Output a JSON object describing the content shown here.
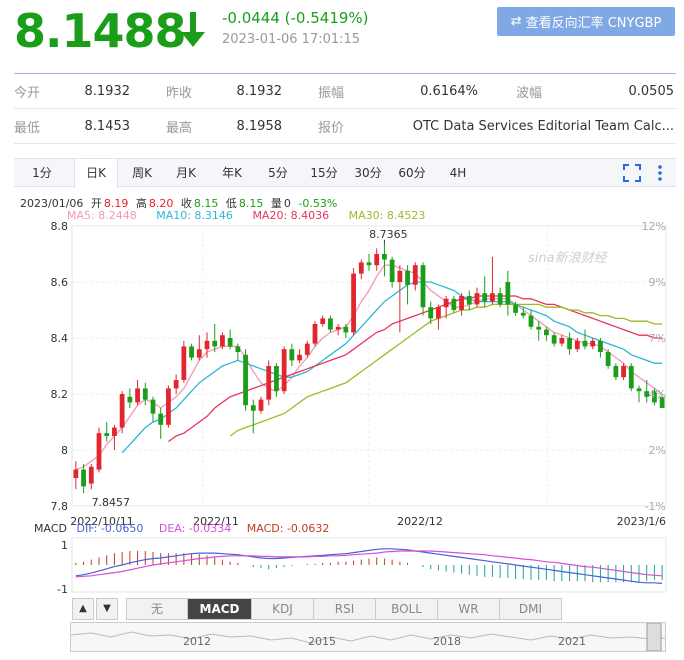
{
  "quote": {
    "price": "8.1488",
    "change": "-0.0444 (-0.5419%)",
    "datetime": "2023-01-06 17:01:15",
    "reverse_button": "查看反向汇率 CNYGBP",
    "down_color": "#1a9e1a",
    "up_color": "#e0262e"
  },
  "stats": [
    [
      {
        "label": "今开",
        "value": "8.1932"
      },
      {
        "label": "昨收",
        "value": "8.1932"
      },
      {
        "label": "振幅",
        "value": "0.6164%"
      },
      {
        "label": "波幅",
        "value": "0.0505"
      }
    ],
    [
      {
        "label": "最低",
        "value": "8.1453"
      },
      {
        "label": "最高",
        "value": "8.1958"
      },
      {
        "label": "报价",
        "value": "OTC Data Services Editorial Team Calc..."
      }
    ]
  ],
  "periods": [
    "1分",
    "日K",
    "周K",
    "月K",
    "年K",
    "5分",
    "15分",
    "30分",
    "60分",
    "4H"
  ],
  "active_period": "日K",
  "ohlc_line": {
    "date": "2023/01/06",
    "open_label": "开",
    "open": "8.19",
    "high_label": "高",
    "high": "8.20",
    "close_label": "收",
    "close": "8.15",
    "low_label": "低",
    "low": "8.15",
    "vol_label": "量",
    "vol": "0",
    "pct": "-0.53%"
  },
  "ma_legend": [
    {
      "text": "MA5: 8.2448",
      "color": "#f09ab6"
    },
    {
      "text": "MA10: 8.3146",
      "color": "#2db7d6"
    },
    {
      "text": "MA20: 8.4036",
      "color": "#e8335b"
    },
    {
      "text": "MA30: 8.4523",
      "color": "#9fb82a"
    }
  ],
  "watermark": "sina新浪财经",
  "chart_data": {
    "type": "candlestick",
    "y_ticks": [
      "8.8",
      "8.6",
      "8.4",
      "8.2",
      "8",
      "7.8"
    ],
    "pct_ticks": [
      "12%",
      "9%",
      "7%",
      "4%",
      "2%",
      "-1%"
    ],
    "ylim": [
      7.8,
      8.8
    ],
    "x_labels": [
      "2022/10/11",
      "2022/11",
      "2022/12",
      "2023/1/6"
    ],
    "max_label": "8.7365",
    "min_label": "7.8457",
    "candles": [
      [
        7.9,
        7.93,
        7.96,
        7.86
      ],
      [
        7.93,
        7.87,
        7.95,
        7.8457
      ],
      [
        7.88,
        7.94,
        7.95,
        7.86
      ],
      [
        7.93,
        8.06,
        8.08,
        7.92
      ],
      [
        8.06,
        8.05,
        8.1,
        8.03
      ],
      [
        8.05,
        8.08,
        8.09,
        8.0
      ],
      [
        8.08,
        8.2,
        8.21,
        8.06
      ],
      [
        8.19,
        8.17,
        8.22,
        8.15
      ],
      [
        8.17,
        8.22,
        8.25,
        8.16
      ],
      [
        8.22,
        8.18,
        8.24,
        8.16
      ],
      [
        8.18,
        8.13,
        8.19,
        8.1
      ],
      [
        8.13,
        8.09,
        8.15,
        8.04
      ],
      [
        8.09,
        8.22,
        8.23,
        8.08
      ],
      [
        8.22,
        8.25,
        8.27,
        8.2
      ],
      [
        8.25,
        8.37,
        8.39,
        8.24
      ],
      [
        8.37,
        8.33,
        8.38,
        8.32
      ],
      [
        8.33,
        8.36,
        8.41,
        8.32
      ],
      [
        8.36,
        8.39,
        8.42,
        8.33
      ],
      [
        8.39,
        8.37,
        8.45,
        8.35
      ],
      [
        8.37,
        8.41,
        8.42,
        8.36
      ],
      [
        8.4,
        8.37,
        8.43,
        8.36
      ],
      [
        8.37,
        8.35,
        8.38,
        8.32
      ],
      [
        8.34,
        8.16,
        8.36,
        8.14
      ],
      [
        8.16,
        8.14,
        8.18,
        8.06
      ],
      [
        8.14,
        8.18,
        8.19,
        8.13
      ],
      [
        8.18,
        8.3,
        8.32,
        8.16
      ],
      [
        8.3,
        8.21,
        8.31,
        8.19
      ],
      [
        8.21,
        8.36,
        8.37,
        8.2
      ],
      [
        8.36,
        8.32,
        8.38,
        8.3
      ],
      [
        8.32,
        8.34,
        8.36,
        8.31
      ],
      [
        8.34,
        8.38,
        8.39,
        8.33
      ],
      [
        8.38,
        8.45,
        8.46,
        8.37
      ],
      [
        8.45,
        8.47,
        8.48,
        8.44
      ],
      [
        8.47,
        8.43,
        8.48,
        8.42
      ],
      [
        8.43,
        8.44,
        8.45,
        8.41
      ],
      [
        8.44,
        8.42,
        8.45,
        8.4
      ],
      [
        8.42,
        8.63,
        8.65,
        8.41
      ],
      [
        8.63,
        8.67,
        8.68,
        8.61
      ],
      [
        8.67,
        8.66,
        8.7,
        8.64
      ],
      [
        8.66,
        8.7,
        8.72,
        8.64
      ],
      [
        8.7,
        8.68,
        8.7365,
        8.62
      ],
      [
        8.68,
        8.6,
        8.69,
        8.58
      ],
      [
        8.6,
        8.64,
        8.66,
        8.42
      ],
      [
        8.64,
        8.59,
        8.66,
        8.52
      ],
      [
        8.59,
        8.66,
        8.67,
        8.57
      ],
      [
        8.66,
        8.51,
        8.67,
        8.48
      ],
      [
        8.51,
        8.47,
        8.53,
        8.45
      ],
      [
        8.47,
        8.51,
        8.52,
        8.43
      ],
      [
        8.51,
        8.54,
        8.55,
        8.47
      ],
      [
        8.54,
        8.5,
        8.55,
        8.49
      ],
      [
        8.5,
        8.55,
        8.56,
        8.48
      ],
      [
        8.55,
        8.52,
        8.57,
        8.5
      ],
      [
        8.52,
        8.56,
        8.58,
        8.51
      ],
      [
        8.56,
        8.53,
        8.62,
        8.51
      ],
      [
        8.53,
        8.56,
        8.69,
        8.52
      ],
      [
        8.56,
        8.52,
        8.58,
        8.51
      ],
      [
        8.6,
        8.52,
        8.64,
        8.48
      ],
      [
        8.52,
        8.49,
        8.53,
        8.48
      ],
      [
        8.49,
        8.48,
        8.51,
        8.47
      ],
      [
        8.48,
        8.44,
        8.5,
        8.43
      ],
      [
        8.44,
        8.43,
        8.46,
        8.39
      ],
      [
        8.43,
        8.41,
        8.44,
        8.39
      ],
      [
        8.41,
        8.38,
        8.42,
        8.37
      ],
      [
        8.38,
        8.4,
        8.41,
        8.37
      ],
      [
        8.4,
        8.36,
        8.42,
        8.34
      ],
      [
        8.36,
        8.39,
        8.4,
        8.35
      ],
      [
        8.39,
        8.37,
        8.43,
        8.36
      ],
      [
        8.37,
        8.39,
        8.4,
        8.36
      ],
      [
        8.39,
        8.35,
        8.4,
        8.33
      ],
      [
        8.35,
        8.3,
        8.36,
        8.29
      ],
      [
        8.3,
        8.26,
        8.31,
        8.25
      ],
      [
        8.26,
        8.3,
        8.31,
        8.25
      ],
      [
        8.3,
        8.22,
        8.31,
        8.21
      ],
      [
        8.22,
        8.21,
        8.23,
        8.17
      ],
      [
        8.21,
        8.19,
        8.25,
        8.17
      ],
      [
        8.21,
        8.17,
        8.22,
        8.16
      ],
      [
        8.19,
        8.15,
        8.2,
        8.15
      ]
    ],
    "ma": {
      "MA5": [
        7.93,
        7.94,
        7.96,
        7.98,
        8.02,
        8.05,
        8.08,
        8.12,
        8.16,
        8.18,
        8.17,
        8.15,
        8.17,
        8.19,
        8.22,
        8.27,
        8.32,
        8.35,
        8.36,
        8.37,
        8.37,
        8.37,
        8.33,
        8.28,
        8.24,
        8.22,
        8.21,
        8.23,
        8.26,
        8.3,
        8.33,
        8.37,
        8.4,
        8.42,
        8.43,
        8.44,
        8.48,
        8.53,
        8.57,
        8.62,
        8.66,
        8.66,
        8.65,
        8.64,
        8.63,
        8.6,
        8.57,
        8.55,
        8.53,
        8.51,
        8.51,
        8.52,
        8.53,
        8.54,
        8.54,
        8.54,
        8.54,
        8.52,
        8.5,
        8.48,
        8.46,
        8.44,
        8.42,
        8.41,
        8.4,
        8.39,
        8.38,
        8.38,
        8.37,
        8.35,
        8.33,
        8.31,
        8.28,
        8.26,
        8.24,
        8.22,
        8.2
      ],
      "MA10": [
        null,
        null,
        null,
        null,
        null,
        null,
        7.99,
        8.02,
        8.05,
        8.08,
        8.1,
        8.11,
        8.13,
        8.15,
        8.18,
        8.21,
        8.24,
        8.26,
        8.28,
        8.3,
        8.31,
        8.32,
        8.31,
        8.3,
        8.29,
        8.28,
        8.27,
        8.26,
        8.26,
        8.27,
        8.28,
        8.3,
        8.32,
        8.34,
        8.36,
        8.38,
        8.41,
        8.44,
        8.47,
        8.5,
        8.53,
        8.55,
        8.57,
        8.59,
        8.6,
        8.6,
        8.6,
        8.59,
        8.58,
        8.57,
        8.55,
        8.54,
        8.53,
        8.53,
        8.53,
        8.53,
        8.53,
        8.52,
        8.51,
        8.5,
        8.49,
        8.48,
        8.46,
        8.45,
        8.44,
        8.42,
        8.41,
        8.4,
        8.39,
        8.38,
        8.37,
        8.36,
        8.34,
        8.33,
        8.32,
        8.31,
        8.31
      ],
      "MA20": [
        null,
        null,
        null,
        null,
        null,
        null,
        null,
        null,
        null,
        null,
        null,
        null,
        8.03,
        8.05,
        8.06,
        8.08,
        8.1,
        8.12,
        8.15,
        8.17,
        8.19,
        8.2,
        8.21,
        8.22,
        8.23,
        8.24,
        8.25,
        8.26,
        8.27,
        8.28,
        8.29,
        8.3,
        8.31,
        8.32,
        8.33,
        8.34,
        8.36,
        8.38,
        8.4,
        8.42,
        8.43,
        8.45,
        8.46,
        8.47,
        8.48,
        8.49,
        8.5,
        8.51,
        8.52,
        8.53,
        8.54,
        8.54,
        8.55,
        8.55,
        8.55,
        8.55,
        8.55,
        8.55,
        8.54,
        8.54,
        8.53,
        8.52,
        8.52,
        8.51,
        8.5,
        8.49,
        8.48,
        8.47,
        8.46,
        8.45,
        8.44,
        8.43,
        8.42,
        8.41,
        8.41,
        8.4,
        8.4
      ],
      "MA30": [
        null,
        null,
        null,
        null,
        null,
        null,
        null,
        null,
        null,
        null,
        null,
        null,
        null,
        null,
        null,
        null,
        null,
        null,
        null,
        null,
        8.05,
        8.07,
        8.08,
        8.09,
        8.1,
        8.11,
        8.12,
        8.13,
        8.15,
        8.17,
        8.19,
        8.2,
        8.21,
        8.22,
        8.23,
        8.24,
        8.26,
        8.28,
        8.3,
        8.32,
        8.34,
        8.36,
        8.38,
        8.4,
        8.42,
        8.44,
        8.46,
        8.47,
        8.48,
        8.49,
        8.5,
        8.5,
        8.51,
        8.51,
        8.52,
        8.52,
        8.52,
        8.52,
        8.52,
        8.52,
        8.52,
        8.51,
        8.51,
        8.51,
        8.5,
        8.5,
        8.49,
        8.49,
        8.48,
        8.48,
        8.47,
        8.47,
        8.46,
        8.46,
        8.46,
        8.45,
        8.45
      ]
    },
    "macd": {
      "y_ticks": [
        "1",
        "-1"
      ],
      "dif": [
        -0.2,
        -0.18,
        -0.15,
        -0.11,
        -0.07,
        -0.03,
        0.0,
        0.04,
        0.07,
        0.1,
        0.12,
        0.13,
        0.15,
        0.17,
        0.19,
        0.21,
        0.22,
        0.22,
        0.22,
        0.21,
        0.2,
        0.19,
        0.17,
        0.15,
        0.13,
        0.12,
        0.12,
        0.13,
        0.14,
        0.15,
        0.16,
        0.17,
        0.18,
        0.19,
        0.2,
        0.21,
        0.23,
        0.25,
        0.27,
        0.29,
        0.3,
        0.3,
        0.29,
        0.28,
        0.26,
        0.24,
        0.22,
        0.2,
        0.18,
        0.16,
        0.14,
        0.12,
        0.1,
        0.08,
        0.06,
        0.04,
        0.02,
        0.0,
        -0.02,
        -0.04,
        -0.06,
        -0.08,
        -0.1,
        -0.12,
        -0.14,
        -0.16,
        -0.18,
        -0.2,
        -0.22,
        -0.24,
        -0.26,
        -0.28,
        -0.3,
        -0.32,
        -0.33,
        -0.33,
        -0.34
      ],
      "dea": [
        -0.22,
        -0.21,
        -0.2,
        -0.18,
        -0.16,
        -0.14,
        -0.12,
        -0.09,
        -0.06,
        -0.03,
        0.0,
        0.02,
        0.04,
        0.06,
        0.08,
        0.1,
        0.12,
        0.13,
        0.15,
        0.16,
        0.17,
        0.17,
        0.17,
        0.17,
        0.16,
        0.16,
        0.15,
        0.15,
        0.15,
        0.15,
        0.15,
        0.16,
        0.16,
        0.17,
        0.17,
        0.18,
        0.19,
        0.2,
        0.21,
        0.22,
        0.24,
        0.25,
        0.26,
        0.26,
        0.26,
        0.26,
        0.26,
        0.25,
        0.24,
        0.23,
        0.22,
        0.21,
        0.2,
        0.19,
        0.17,
        0.16,
        0.14,
        0.13,
        0.11,
        0.1,
        0.08,
        0.06,
        0.05,
        0.03,
        0.01,
        -0.01,
        -0.03,
        -0.04,
        -0.06,
        -0.08,
        -0.1,
        -0.12,
        -0.14,
        -0.16,
        -0.18,
        -0.19,
        -0.2
      ]
    },
    "timeline_years": [
      "2012",
      "2015",
      "2018",
      "2021"
    ]
  },
  "macd_legend": [
    {
      "text": "MACD",
      "color": "#333333"
    },
    {
      "text": "DIF: -0.0650",
      "color": "#4a5fd8"
    },
    {
      "text": "DEA: -0.0334",
      "color": "#d64fd6"
    },
    {
      "text": "MACD: -0.0632",
      "color": "#c0392b"
    }
  ],
  "indicators": [
    "无",
    "MACD",
    "KDJ",
    "RSI",
    "BOLL",
    "WR",
    "DMI"
  ],
  "active_indicator": "MACD",
  "nav": {
    "up": "▲",
    "down": "▼"
  }
}
